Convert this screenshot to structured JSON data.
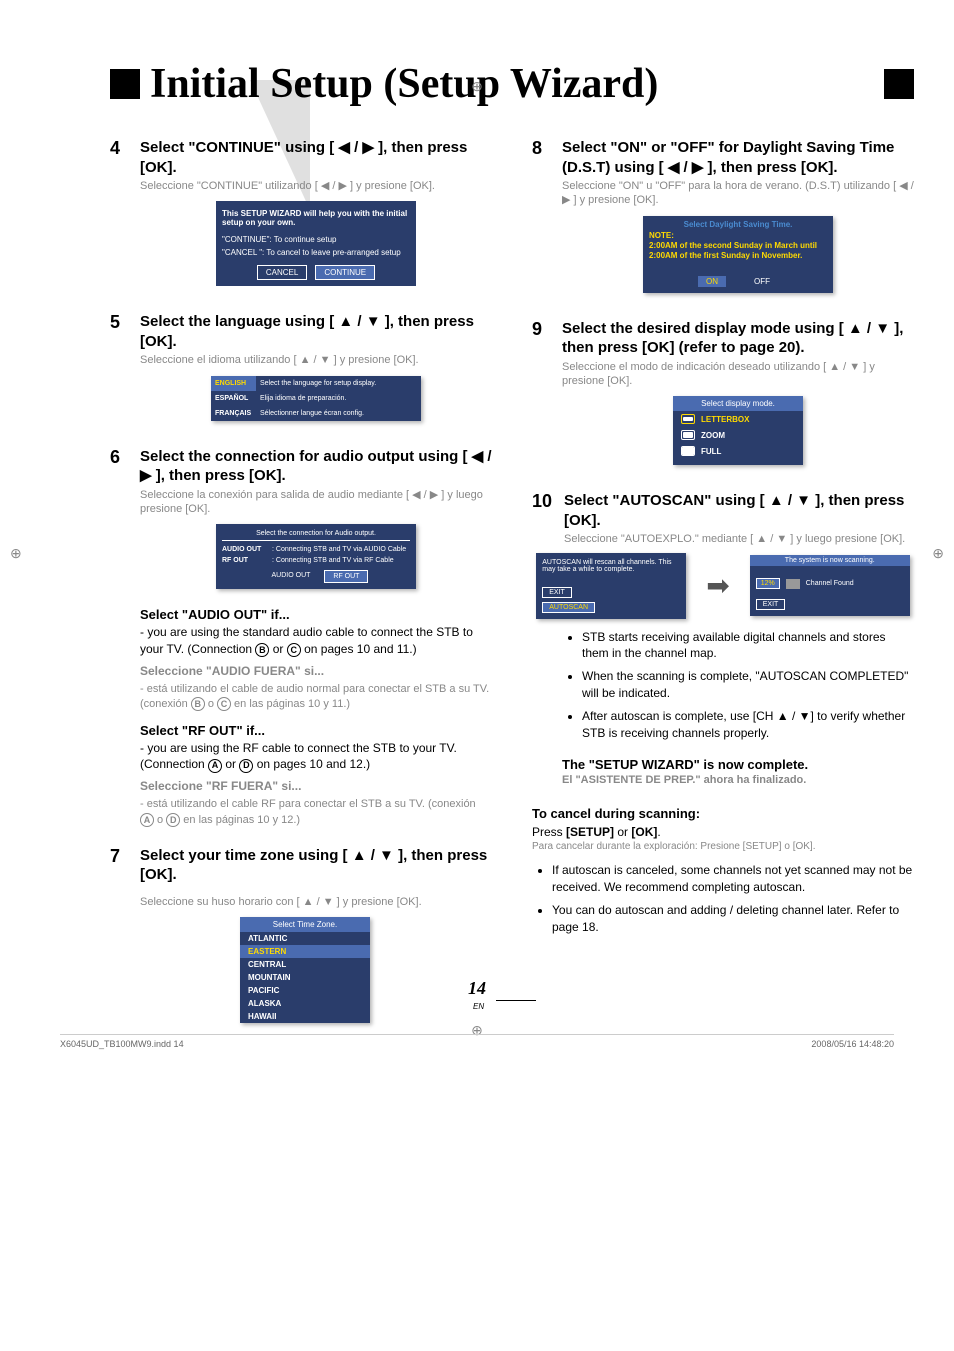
{
  "title": "Initial Setup (Setup Wizard)",
  "page_number": "14",
  "page_en": "EN",
  "footer_left": "X6045UD_TB100MW9.indd   14",
  "footer_right": "2008/05/16   14:48:20",
  "left_col": {
    "step4": {
      "num": "4",
      "title_a": "Select \"CONTINUE\" using [ ◀ / ▶ ], then press [OK].",
      "sub": "Seleccione \"CONTINUE\" utilizando [ ◀ / ▶ ] y presione [OK].",
      "dialog": {
        "line1": "This SETUP WIZARD will help you with the initial setup on your own.",
        "line2a": "\"CONTINUE\": To continue setup",
        "line2b": "\"CANCEL    \": To cancel to leave pre-arranged setup",
        "btn1": "CANCEL",
        "btn2": "CONTINUE"
      }
    },
    "step5": {
      "num": "5",
      "title": "Select the language using [ ▲ / ▼ ], then press [OK].",
      "sub": "Seleccione el idioma utilizando [ ▲ / ▼ ] y presione [OK].",
      "dialog": {
        "r1_label": "ENGLISH",
        "r1_text": "Select the language for setup display.",
        "r2_label": "ESPAÑOL",
        "r2_text": "Elija idioma de preparación.",
        "r3_label": "FRANÇAIS",
        "r3_text": "Sélectionner langue écran config."
      }
    },
    "step6": {
      "num": "6",
      "title": "Select the connection for audio output using [ ◀ / ▶ ], then press [OK].",
      "sub": "Seleccione la conexión para salida de audio mediante [ ◀ / ▶ ] y luego presione [OK].",
      "dialog": {
        "title": "Select the connection for Audio output.",
        "r1_k": "AUDIO OUT",
        "r1_v": ": Connecting STB and TV via AUDIO Cable",
        "r2_k": "RF OUT",
        "r2_v": ": Connecting STB and TV via RF Cable",
        "btn1": "AUDIO OUT",
        "btn2": "RF OUT"
      },
      "sub1_head": "Select \"AUDIO OUT\" if...",
      "sub1_body_a": "- you are using the standard audio cable to connect the STB to your TV. (Connection ",
      "sub1_body_b": " or ",
      "sub1_body_c": " on pages 10 and 11.)",
      "sub1_gray_head": "Seleccione \"AUDIO FUERA\" si...",
      "sub1_gray_body_a": "- está utilizando el cable de audio normal para conectar el STB a su TV. (conexión ",
      "sub1_gray_body_b": " o ",
      "sub1_gray_body_c": " en las páginas 10 y 11.)",
      "sub2_head": "Select \"RF OUT\" if...",
      "sub2_body_a": "- you are using the RF cable to connect the STB to your TV. (Connection ",
      "sub2_body_b": " or ",
      "sub2_body_c": " on pages 10 and 12.)",
      "sub2_gray_head": "Seleccione \"RF FUERA\" si...",
      "sub2_gray_body_a": "- está utilizando el cable RF para conectar el STB a su TV. (conexión ",
      "sub2_gray_body_b": " o ",
      "sub2_gray_body_c": " en las páginas 10 y 12.)"
    },
    "step7": {
      "num": "7",
      "title": "Select your time zone using [ ▲ / ▼ ], then press [OK].",
      "sub": "Seleccione su huso horario con  [ ▲ / ▼ ] y presione [OK].",
      "dialog": {
        "title": "Select Time Zone.",
        "items": [
          "ATLANTIC",
          "EASTERN",
          "CENTRAL",
          "MOUNTAIN",
          "PACIFIC",
          "ALASKA",
          "HAWAII"
        ],
        "highlight_index": 1
      }
    }
  },
  "right_col": {
    "step8": {
      "num": "8",
      "title": "Select \"ON\" or \"OFF\" for Daylight Saving Time (D.S.T) using [ ◀ / ▶ ], then press [OK].",
      "sub": "Seleccione \"ON\" u \"OFF\" para la hora de verano. (D.S.T) utilizando [ ◀ / ▶ ] y presione [OK].",
      "dialog": {
        "title": "Select Daylight Saving Time.",
        "note_label": "NOTE:",
        "note": "2:00AM of the second Sunday in March until 2:00AM of the first Sunday in November.",
        "btn1": "ON",
        "btn2": "OFF"
      }
    },
    "step9": {
      "num": "9",
      "title": "Select the desired display mode using [ ▲ / ▼ ], then press [OK] (refer to page 20).",
      "sub": "Seleccione el modo de indicación deseado utilizando [ ▲ / ▼ ] y presione [OK].",
      "dialog": {
        "title": "Select display mode.",
        "items": [
          "LETTERBOX",
          "ZOOM",
          "FULL"
        ]
      }
    },
    "step10": {
      "num": "10",
      "title": "Select \"AUTOSCAN\" using [ ▲ / ▼ ], then press [OK].",
      "sub": "Seleccione \"AUTOEXPLO.\" mediante [ ▲ / ▼ ] y luego presione [OK].",
      "left_dialog": {
        "line1": "AUTOSCAN will rescan all channels. This may take a while to complete.",
        "btn1": "EXIT",
        "btn2": "AUTOSCAN"
      },
      "right_dialog": {
        "title": "The system is now scanning.",
        "pct": "12%",
        "found": "Channel Found",
        "btn": "EXIT"
      },
      "bullets": [
        "STB starts receiving available digital channels and stores them in the channel map.",
        "When the scanning is complete, \"AUTOSCAN COMPLETED\" will be indicated.",
        "After autoscan is complete, use [CH ▲ / ▼] to verify whether STB is receiving channels properly."
      ],
      "complete": "The \"SETUP WIZARD\" is now complete.",
      "complete_sub": "El \"ASISTENTE DE PREP.\" ahora ha finalizado."
    },
    "cancel": {
      "head": "To cancel during scanning:",
      "body_a": "Press ",
      "body_b": " or ",
      "body_c": ".",
      "body_key1": "[SETUP]",
      "body_key2": "[OK]",
      "sub": "Para cancelar durante la exploración: Presione [SETUP] o [OK].",
      "bullets": [
        "If autoscan is canceled, some channels not yet scanned may not be received. We recommend completing autoscan.",
        "You can do autoscan and adding / deleting channel later. Refer to page 18."
      ]
    }
  },
  "letters": {
    "A": "A",
    "B": "B",
    "C": "C",
    "D": "D"
  }
}
